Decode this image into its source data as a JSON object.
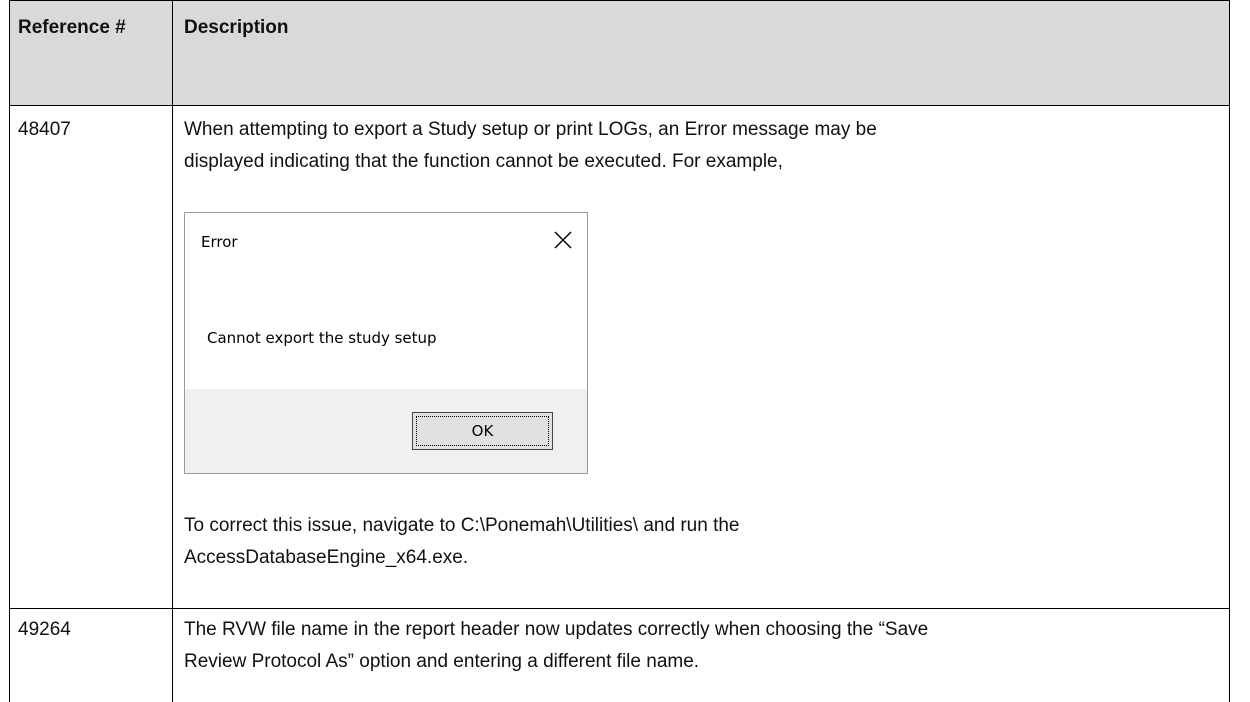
{
  "table": {
    "headers": {
      "reference": "Reference #",
      "description": "Description"
    },
    "rows": [
      {
        "reference": "48407",
        "description_lines": [
          "When attempting to export a Study setup or print LOGs, an Error message may be",
          "displayed indicating that the function cannot be executed. For example,"
        ],
        "resolution_lines": [
          "To correct this issue, navigate to C:\\Ponemah\\Utilities\\ and run the",
          "AccessDatabaseEngine_x64.exe."
        ]
      },
      {
        "reference": "49264",
        "description_lines": [
          "The RVW file name in the report header now updates correctly when choosing the “Save",
          "Review Protocol As” option and entering a different file name."
        ]
      }
    ]
  },
  "dialog": {
    "title": "Error",
    "message": "Cannot export the study setup",
    "ok_label": "OK",
    "close_icon": "close-x-icon"
  }
}
